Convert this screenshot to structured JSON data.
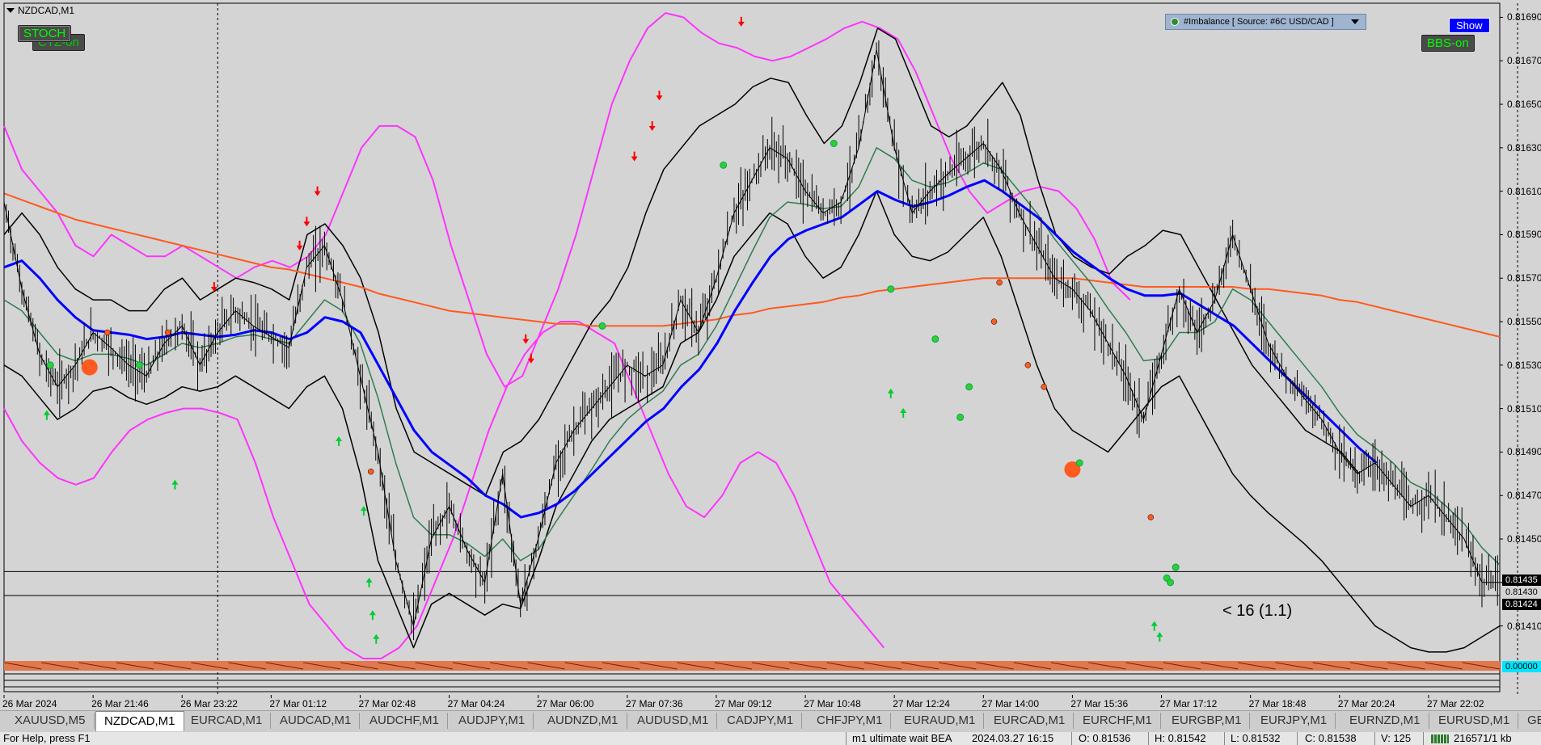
{
  "window": {
    "symbol_title": "NZDCAD,M1"
  },
  "indicator_buttons": {
    "stoch": "STOCH",
    "ctz": "CTZ-on",
    "bbs": "BBS-on",
    "show": "Show"
  },
  "imbalance_panel": {
    "label": "#Imbalance [ Source: #6C USD/CAD ]"
  },
  "current_label": "< 16 (1.1)",
  "colors": {
    "chart_bg": "#d4d4d4",
    "candles": "#000000",
    "envelope_outer": "#ff33ff",
    "envelope_inner": "#000000",
    "ma_blue": "#0000ff",
    "ma_orange": "#ff5a1f",
    "ma_green": "#2e7d4f",
    "buy_arrow": "#00cc33",
    "sell_arrow": "#ff0000",
    "dot_orange": "#ff5a1f",
    "dot_green": "#33cc33"
  },
  "price_tags": {
    "hline_upper": "0.81435",
    "hline_lower": "0.81424",
    "bid_tag": "0.81430",
    "cyan_tag": "0.00000"
  },
  "chart_data": {
    "type": "line",
    "title": "",
    "xlabel": "",
    "ylabel": "",
    "ylim": [
      0.81395,
      0.81695
    ],
    "y_ticks": [
      "0.81690",
      "0.81670",
      "0.81650",
      "0.81630",
      "0.81610",
      "0.81590",
      "0.81570",
      "0.81550",
      "0.81530",
      "0.81510",
      "0.81490",
      "0.81470",
      "0.81450",
      "0.81430",
      "0.81410"
    ],
    "y_tick_values": [
      0.8169,
      0.8167,
      0.8165,
      0.8163,
      0.8161,
      0.8159,
      0.8157,
      0.8155,
      0.8153,
      0.8151,
      0.8149,
      0.8147,
      0.8145,
      0.8143,
      0.8141
    ],
    "x_labels": [
      "26 Mar 2024",
      "26 Mar 21:46",
      "26 Mar 23:22",
      "27 Mar 01:12",
      "27 Mar 02:48",
      "27 Mar 04:24",
      "27 Mar 06:00",
      "27 Mar 07:36",
      "27 Mar 09:12",
      "27 Mar 10:48",
      "27 Mar 12:24",
      "27 Mar 14:00",
      "27 Mar 15:36",
      "27 Mar 17:12",
      "27 Mar 18:48",
      "27 Mar 20:24",
      "27 Mar 22:02"
    ],
    "x_label_index": [
      0,
      5,
      10,
      15,
      20,
      25,
      30,
      35,
      40,
      45,
      50,
      55,
      60,
      65,
      70,
      75,
      80
    ],
    "vertical_lines_at": [
      12,
      85
    ],
    "horizontal_lines": [
      0.81435,
      0.81424
    ],
    "series": [
      {
        "name": "",
        "role": "price",
        "values": [
          0.81605,
          0.81565,
          0.81535,
          0.8152,
          0.8153,
          0.81545,
          0.81538,
          0.8153,
          0.81525,
          0.8154,
          0.81548,
          0.8153,
          0.81545,
          0.81555,
          0.81548,
          0.81543,
          0.81538,
          0.81575,
          0.81585,
          0.8156,
          0.81525,
          0.8149,
          0.8144,
          0.8141,
          0.8145,
          0.81465,
          0.81445,
          0.8143,
          0.8148,
          0.8142,
          0.8145,
          0.81485,
          0.815,
          0.8151,
          0.8152,
          0.8153,
          0.81525,
          0.8153,
          0.8156,
          0.81545,
          0.8157,
          0.816,
          0.81615,
          0.8163,
          0.81625,
          0.8161,
          0.816,
          0.81605,
          0.8163,
          0.81675,
          0.8163,
          0.816,
          0.8161,
          0.81618,
          0.81625,
          0.81632,
          0.8162,
          0.816,
          0.81585,
          0.8157,
          0.81565,
          0.81555,
          0.8154,
          0.81525,
          0.81505,
          0.81535,
          0.81565,
          0.81545,
          0.8156,
          0.8159,
          0.81565,
          0.8154,
          0.81525,
          0.81515,
          0.81505,
          0.8149,
          0.8148,
          0.81485,
          0.81475,
          0.81465,
          0.8147,
          0.8146,
          0.8145,
          0.8143,
          0.8143
        ]
      },
      {
        "name": "",
        "role": "ma_orange",
        "values": [
          0.81609,
          0.81606,
          0.81603,
          0.816,
          0.81597,
          0.81595,
          0.81593,
          0.81591,
          0.81589,
          0.81587,
          0.81585,
          0.81583,
          0.81581,
          0.81579,
          0.81577,
          0.81575,
          0.81574,
          0.81572,
          0.8157,
          0.81568,
          0.81566,
          0.81563,
          0.81561,
          0.81559,
          0.81557,
          0.81555,
          0.81554,
          0.81553,
          0.81552,
          0.81551,
          0.8155,
          0.81549,
          0.81549,
          0.81548,
          0.81548,
          0.81548,
          0.81548,
          0.81548,
          0.81549,
          0.8155,
          0.81551,
          0.81553,
          0.81554,
          0.81556,
          0.81557,
          0.81558,
          0.81559,
          0.81561,
          0.81562,
          0.81564,
          0.81565,
          0.81566,
          0.81567,
          0.81568,
          0.81569,
          0.8157,
          0.8157,
          0.8157,
          0.8157,
          0.8157,
          0.8157,
          0.81569,
          0.81568,
          0.81567,
          0.81566,
          0.81566,
          0.81566,
          0.81566,
          0.81566,
          0.81566,
          0.81565,
          0.81565,
          0.81564,
          0.81563,
          0.81562,
          0.8156,
          0.81559,
          0.81557,
          0.81555,
          0.81553,
          0.81551,
          0.81549,
          0.81547,
          0.81545,
          0.81543
        ]
      },
      {
        "name": "",
        "role": "ma_blue",
        "values": [
          0.81575,
          0.81578,
          0.8157,
          0.8156,
          0.81552,
          0.81546,
          0.81545,
          0.81544,
          0.81542,
          0.81543,
          0.81545,
          0.81544,
          0.81543,
          0.81544,
          0.81546,
          0.81545,
          0.81542,
          0.81545,
          0.81552,
          0.8155,
          0.81545,
          0.8153,
          0.81515,
          0.815,
          0.8149,
          0.81484,
          0.81478,
          0.8147,
          0.81466,
          0.8146,
          0.81462,
          0.81466,
          0.81472,
          0.8148,
          0.81488,
          0.81496,
          0.81504,
          0.8151,
          0.8152,
          0.81528,
          0.8154,
          0.81555,
          0.81568,
          0.8158,
          0.81588,
          0.81592,
          0.81595,
          0.81598,
          0.81604,
          0.8161,
          0.81606,
          0.81603,
          0.81605,
          0.81608,
          0.81612,
          0.81615,
          0.8161,
          0.81604,
          0.81598,
          0.8159,
          0.81582,
          0.81576,
          0.8157,
          0.81565,
          0.81562,
          0.81562,
          0.81563,
          0.81558,
          0.81553,
          0.81548,
          0.8154,
          0.81532,
          0.81524,
          0.81516,
          0.81508,
          0.815,
          0.81492,
          0.81485
        ]
      },
      {
        "name": "",
        "role": "ma_green",
        "values": [
          0.8156,
          0.81555,
          0.81545,
          0.81535,
          0.81532,
          0.81535,
          0.81535,
          0.81533,
          0.8153,
          0.81535,
          0.8154,
          0.81538,
          0.8154,
          0.81543,
          0.81544,
          0.81542,
          0.8154,
          0.8155,
          0.8156,
          0.81555,
          0.8154,
          0.81515,
          0.81485,
          0.8146,
          0.81452,
          0.81452,
          0.81448,
          0.81442,
          0.8145,
          0.8144,
          0.81445,
          0.81458,
          0.8147,
          0.81482,
          0.81495,
          0.81505,
          0.81512,
          0.81518,
          0.8153,
          0.81535,
          0.81548,
          0.81565,
          0.81582,
          0.81598,
          0.81605,
          0.81604,
          0.81602,
          0.81603,
          0.81612,
          0.8163,
          0.81625,
          0.81615,
          0.81612,
          0.81614,
          0.81618,
          0.81623,
          0.8162,
          0.8161,
          0.816,
          0.81588,
          0.81578,
          0.81568,
          0.81556,
          0.81545,
          0.81532,
          0.81533,
          0.81545,
          0.81545,
          0.8155,
          0.81565,
          0.8156,
          0.8155,
          0.8154,
          0.8153,
          0.8152,
          0.81508,
          0.81498,
          0.81492,
          0.81485,
          0.81476,
          0.81472,
          0.81465,
          0.81457,
          0.81446,
          0.81438
        ]
      },
      {
        "name": "",
        "role": "env_outer_upper",
        "values": [
          0.8164,
          0.8162,
          0.8161,
          0.816,
          0.81585,
          0.8158,
          0.8159,
          0.81585,
          0.8158,
          0.8158,
          0.81585,
          0.8158,
          0.81575,
          0.8157,
          0.81575,
          0.81578,
          0.81575,
          0.8158,
          0.8159,
          0.8161,
          0.8163,
          0.8164,
          0.8164,
          0.81635,
          0.81615,
          0.81585,
          0.8156,
          0.81535,
          0.8152,
          0.81525,
          0.81545,
          0.81565,
          0.8159,
          0.8162,
          0.8165,
          0.8167,
          0.81685,
          0.81692,
          0.8169,
          0.81683,
          0.81678,
          0.81676,
          0.81672,
          0.8167,
          0.81672,
          0.81676,
          0.8168,
          0.81685,
          0.81688,
          0.81685,
          0.8168,
          0.81665,
          0.81645,
          0.81625,
          0.8161,
          0.816,
          0.81605,
          0.8161,
          0.81612,
          0.8161,
          0.81602,
          0.81588,
          0.81568,
          0.8156
        ]
      },
      {
        "name": "",
        "role": "env_outer_lower",
        "values": [
          0.8151,
          0.81495,
          0.81485,
          0.81478,
          0.81475,
          0.81478,
          0.8149,
          0.815,
          0.81505,
          0.81508,
          0.8151,
          0.8151,
          0.81508,
          0.81505,
          0.81485,
          0.8146,
          0.8144,
          0.8142,
          0.8141,
          0.814,
          0.81395,
          0.81395,
          0.814,
          0.8141,
          0.8143,
          0.8145,
          0.81475,
          0.815,
          0.8152,
          0.81535,
          0.81545,
          0.8155,
          0.8155,
          0.81545,
          0.8154,
          0.8152,
          0.815,
          0.8148,
          0.81465,
          0.8146,
          0.8147,
          0.81485,
          0.8149,
          0.81485,
          0.8147,
          0.8145,
          0.8143,
          0.8142,
          0.8141,
          0.814
        ]
      },
      {
        "name": "",
        "role": "env_inner_upper",
        "values": [
          0.8159,
          0.816,
          0.8159,
          0.81575,
          0.81565,
          0.8156,
          0.8156,
          0.81555,
          0.81555,
          0.81565,
          0.8157,
          0.8156,
          0.81565,
          0.8157,
          0.81568,
          0.81565,
          0.8156,
          0.8159,
          0.81595,
          0.81585,
          0.8157,
          0.81545,
          0.8151,
          0.8149,
          0.81485,
          0.8148,
          0.81475,
          0.8147,
          0.8149,
          0.81495,
          0.81505,
          0.8152,
          0.81535,
          0.8155,
          0.8156,
          0.81575,
          0.816,
          0.8162,
          0.8163,
          0.8164,
          0.81645,
          0.8165,
          0.81658,
          0.81662,
          0.8166,
          0.81645,
          0.81632,
          0.8164,
          0.8166,
          0.81685,
          0.8168,
          0.8166,
          0.8164,
          0.81635,
          0.8164,
          0.8165,
          0.8166,
          0.81645,
          0.81615,
          0.8159,
          0.8158,
          0.81575,
          0.81572,
          0.8158,
          0.81585,
          0.81592,
          0.8159,
          0.81575,
          0.8156,
          0.81545,
          0.8153,
          0.8152,
          0.8151,
          0.815,
          0.81495,
          0.8149,
          0.8148
        ]
      },
      {
        "name": "",
        "role": "env_inner_lower",
        "values": [
          0.8153,
          0.81525,
          0.81515,
          0.81505,
          0.8151,
          0.81518,
          0.8152,
          0.81515,
          0.81512,
          0.81515,
          0.8152,
          0.81518,
          0.8152,
          0.81525,
          0.8152,
          0.81515,
          0.8151,
          0.8152,
          0.81525,
          0.8151,
          0.8148,
          0.8144,
          0.8142,
          0.814,
          0.8142,
          0.81425,
          0.8142,
          0.81415,
          0.8142,
          0.81418,
          0.8144,
          0.81465,
          0.8148,
          0.81495,
          0.81505,
          0.8151,
          0.81515,
          0.8152,
          0.8154,
          0.81545,
          0.8156,
          0.8158,
          0.8159,
          0.816,
          0.81595,
          0.8158,
          0.8157,
          0.81575,
          0.8159,
          0.8161,
          0.8159,
          0.8158,
          0.81578,
          0.81582,
          0.8159,
          0.81598,
          0.8158,
          0.81555,
          0.8153,
          0.8151,
          0.815,
          0.81495,
          0.8149,
          0.815,
          0.8151,
          0.8152,
          0.81525,
          0.8151,
          0.81495,
          0.8148,
          0.8147,
          0.81462,
          0.81455,
          0.81448,
          0.8144,
          0.8143,
          0.8142,
          0.8141,
          0.81405,
          0.814,
          0.81398,
          0.81398,
          0.814,
          0.81405,
          0.8141
        ]
      }
    ],
    "markers": [
      {
        "kind": "buy_arrow",
        "x": 2.4,
        "y": 0.81507
      },
      {
        "kind": "buy_arrow",
        "x": 9.6,
        "y": 0.81475
      },
      {
        "kind": "buy_arrow",
        "x": 18.8,
        "y": 0.81495
      },
      {
        "kind": "buy_arrow",
        "x": 20.2,
        "y": 0.81463
      },
      {
        "kind": "buy_arrow",
        "x": 20.5,
        "y": 0.8143
      },
      {
        "kind": "buy_arrow",
        "x": 20.7,
        "y": 0.81415
      },
      {
        "kind": "buy_arrow",
        "x": 20.9,
        "y": 0.81404
      },
      {
        "kind": "buy_arrow",
        "x": 49.8,
        "y": 0.81517
      },
      {
        "kind": "buy_arrow",
        "x": 50.5,
        "y": 0.81508
      },
      {
        "kind": "buy_arrow",
        "x": 64.6,
        "y": 0.8141
      },
      {
        "kind": "buy_arrow",
        "x": 64.9,
        "y": 0.81405
      },
      {
        "kind": "sell_arrow",
        "x": 11.8,
        "y": 0.81566
      },
      {
        "kind": "sell_arrow",
        "x": 16.6,
        "y": 0.81585
      },
      {
        "kind": "sell_arrow",
        "x": 17.0,
        "y": 0.81596
      },
      {
        "kind": "sell_arrow",
        "x": 17.6,
        "y": 0.8161
      },
      {
        "kind": "sell_arrow",
        "x": 29.3,
        "y": 0.81542
      },
      {
        "kind": "sell_arrow",
        "x": 29.6,
        "y": 0.81533
      },
      {
        "kind": "sell_arrow",
        "x": 35.4,
        "y": 0.81626
      },
      {
        "kind": "sell_arrow",
        "x": 36.4,
        "y": 0.8164
      },
      {
        "kind": "sell_arrow",
        "x": 36.8,
        "y": 0.81654
      },
      {
        "kind": "sell_arrow",
        "x": 41.4,
        "y": 0.81688
      },
      {
        "kind": "big_orange_dot",
        "x": 4.8,
        "y": 0.81529
      },
      {
        "kind": "big_orange_dot",
        "x": 60.0,
        "y": 0.81482
      },
      {
        "kind": "green_dot",
        "x": 2.6,
        "y": 0.8153
      },
      {
        "kind": "green_dot",
        "x": 7.6,
        "y": 0.8153
      },
      {
        "kind": "green_dot",
        "x": 33.6,
        "y": 0.81548
      },
      {
        "kind": "green_dot",
        "x": 40.4,
        "y": 0.81622
      },
      {
        "kind": "green_dot",
        "x": 46.6,
        "y": 0.81632
      },
      {
        "kind": "green_dot",
        "x": 49.8,
        "y": 0.81565
      },
      {
        "kind": "green_dot",
        "x": 52.3,
        "y": 0.81542
      },
      {
        "kind": "green_dot",
        "x": 53.7,
        "y": 0.81506
      },
      {
        "kind": "green_dot",
        "x": 54.2,
        "y": 0.8152
      },
      {
        "kind": "green_dot",
        "x": 60.4,
        "y": 0.81485
      },
      {
        "kind": "green_dot",
        "x": 65.3,
        "y": 0.81432
      },
      {
        "kind": "green_dot",
        "x": 65.8,
        "y": 0.81437
      },
      {
        "kind": "green_dot",
        "x": 65.5,
        "y": 0.8143
      },
      {
        "kind": "orange_dot",
        "x": 5.8,
        "y": 0.81545
      },
      {
        "kind": "orange_dot",
        "x": 9.2,
        "y": 0.81545
      },
      {
        "kind": "orange_dot",
        "x": 20.6,
        "y": 0.81481
      },
      {
        "kind": "orange_dot",
        "x": 55.9,
        "y": 0.81568
      },
      {
        "kind": "orange_dot",
        "x": 55.6,
        "y": 0.8155
      },
      {
        "kind": "orange_dot",
        "x": 57.5,
        "y": 0.8153
      },
      {
        "kind": "orange_dot",
        "x": 58.4,
        "y": 0.8152
      },
      {
        "kind": "orange_dot",
        "x": 64.4,
        "y": 0.8146
      }
    ]
  },
  "tabs": [
    "XAUUSD,M5",
    "NZDCAD,M1",
    "EURCAD,M1",
    "AUDCAD,M1",
    "AUDCHF,M1",
    "AUDJPY,M1",
    "AUDNZD,M1",
    "AUDUSD,M1",
    "CADJPY,M1",
    "CHFJPY,M1",
    "EURAUD,M1",
    "EURCAD,M1",
    "EURCHF,M1",
    "EURGBP,M1",
    "EURJPY,M1",
    "EURNZD,M1",
    "EURUSD,M1",
    "GBPA"
  ],
  "active_tab": "NZDCAD,M1",
  "status_bar": {
    "help": "For Help, press F1",
    "profile": "m1 ultimate wait BEA",
    "datetime": "2024.03.27 16:15",
    "open": "O: 0.81536",
    "high": "H: 0.81542",
    "low": "L: 0.81532",
    "close": "C: 0.81538",
    "volume": "V: 125",
    "traffic": "216571/1 kb"
  }
}
